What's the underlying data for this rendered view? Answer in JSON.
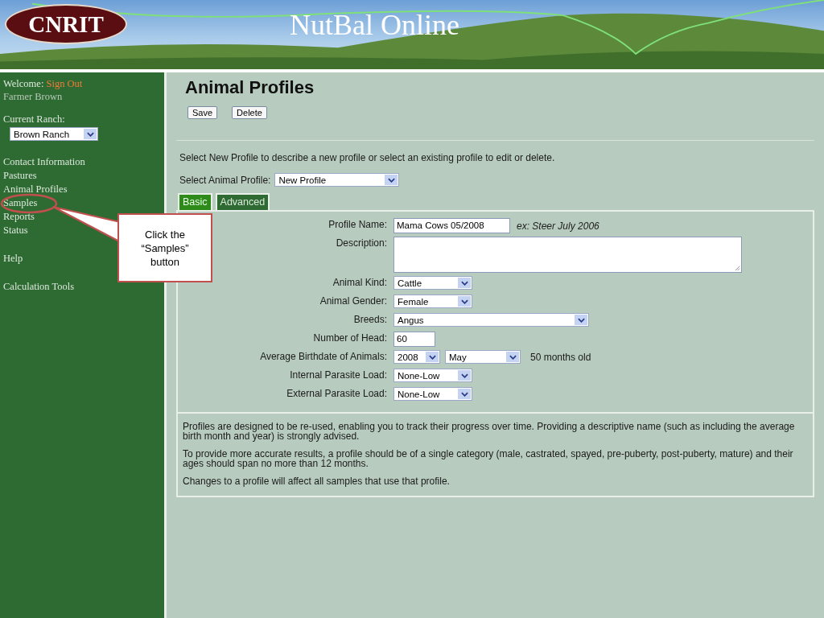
{
  "header": {
    "logo": "CNRIT",
    "title": "NutBal Online"
  },
  "sidebar": {
    "welcome": "Welcome:",
    "sign_out": "Sign Out",
    "user": "Farmer Brown",
    "ranch_label": "Current Ranch:",
    "ranch_value": "Brown Ranch",
    "nav_groups": [
      [
        {
          "label": "Contact Information",
          "highlighted": false
        },
        {
          "label": "Pastures",
          "highlighted": false
        },
        {
          "label": "Animal Profiles",
          "highlighted": false
        },
        {
          "label": "Samples",
          "highlighted": true
        },
        {
          "label": "Reports",
          "highlighted": false
        },
        {
          "label": "Status",
          "highlighted": false
        }
      ],
      [
        {
          "label": "Help",
          "highlighted": false
        }
      ],
      [
        {
          "label": "Calculation Tools",
          "highlighted": false
        }
      ]
    ]
  },
  "callout": {
    "text": "Click the “Samples” button"
  },
  "page": {
    "title": "Animal Profiles",
    "buttons": [
      "Save",
      "Delete"
    ],
    "intro": "Select New Profile to describe a new profile or select an existing profile to edit or delete.",
    "profile_select": {
      "label": "Select Animal Profile:",
      "value": "New Profile"
    },
    "tabs": [
      {
        "label": "Basic",
        "selected": true
      },
      {
        "label": "Advanced",
        "selected": false
      }
    ],
    "fields": [
      {
        "kind": "text",
        "label": "Profile Name:",
        "value": "Mama Cows 05/2008",
        "hint": "ex: Steer July 2006"
      },
      {
        "kind": "textarea",
        "label": "Description:"
      },
      {
        "kind": "select",
        "label": "Animal Kind:",
        "value": "Cattle"
      },
      {
        "kind": "select",
        "label": "Animal Gender:",
        "value": "Female"
      },
      {
        "kind": "wide-select",
        "label": "Breeds:",
        "value": "Angus"
      },
      {
        "kind": "number",
        "label": "Number of Head:",
        "value": "60"
      },
      {
        "kind": "date",
        "label": "Average Birthdate of Animals:",
        "year": "2008",
        "month": "May",
        "note": "50 months old"
      },
      {
        "kind": "select",
        "label": "Internal Parasite Load:",
        "value": "None-Low"
      },
      {
        "kind": "select",
        "label": "External Parasite Load:",
        "value": "None-Low"
      }
    ],
    "notes": [
      "Profiles are designed to be re-used, enabling you to track their progress over time. Providing a descriptive name (such as including the average birth month and year) is strongly advised.",
      "To provide more accurate results, a profile should be of a single category (male, castrated, spayed, pre-puberty, post-puberty, mature) and their ages should span no more than 12 months.",
      "Changes to a profile will affect all samples that use that profile."
    ]
  }
}
